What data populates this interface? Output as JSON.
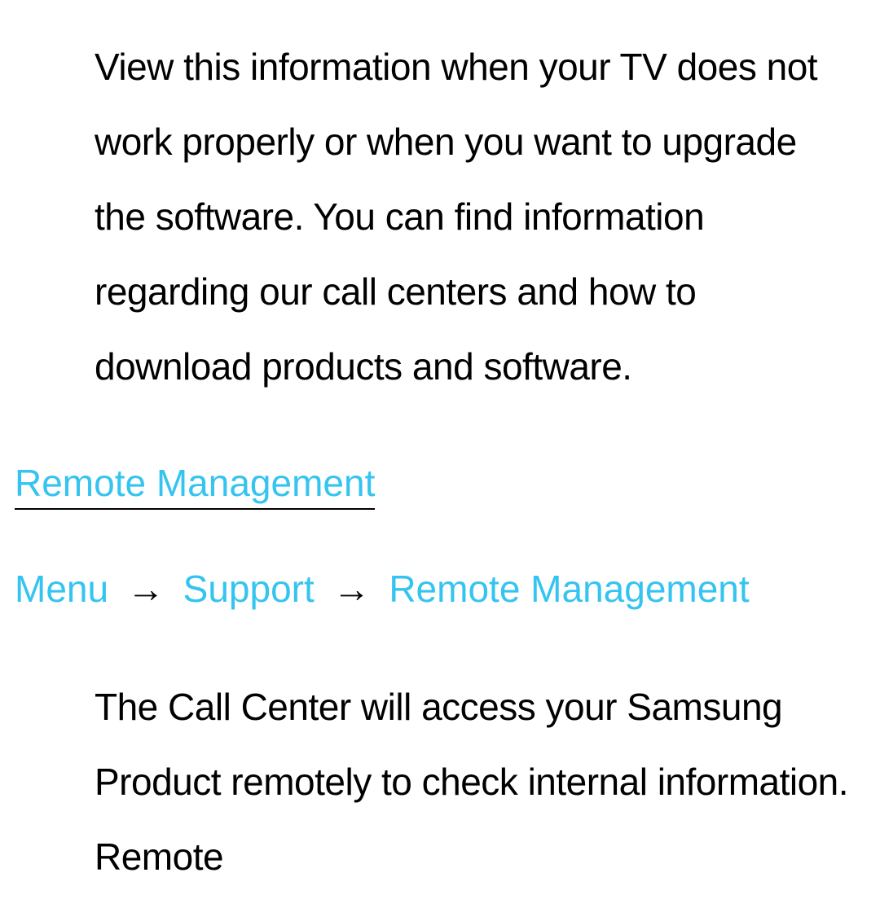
{
  "intro_paragraph": "View this information when your TV does not work properly or when you want to upgrade the software. You can find information regarding our call centers and how to download products and software.",
  "section": {
    "heading": "Remote Management",
    "breadcrumb": {
      "item1": "Menu",
      "sep": "→",
      "item2": "Support",
      "item3": "Remote Management"
    },
    "body": "The Call Center will access your Samsung Product remotely to check internal information. Remote"
  }
}
